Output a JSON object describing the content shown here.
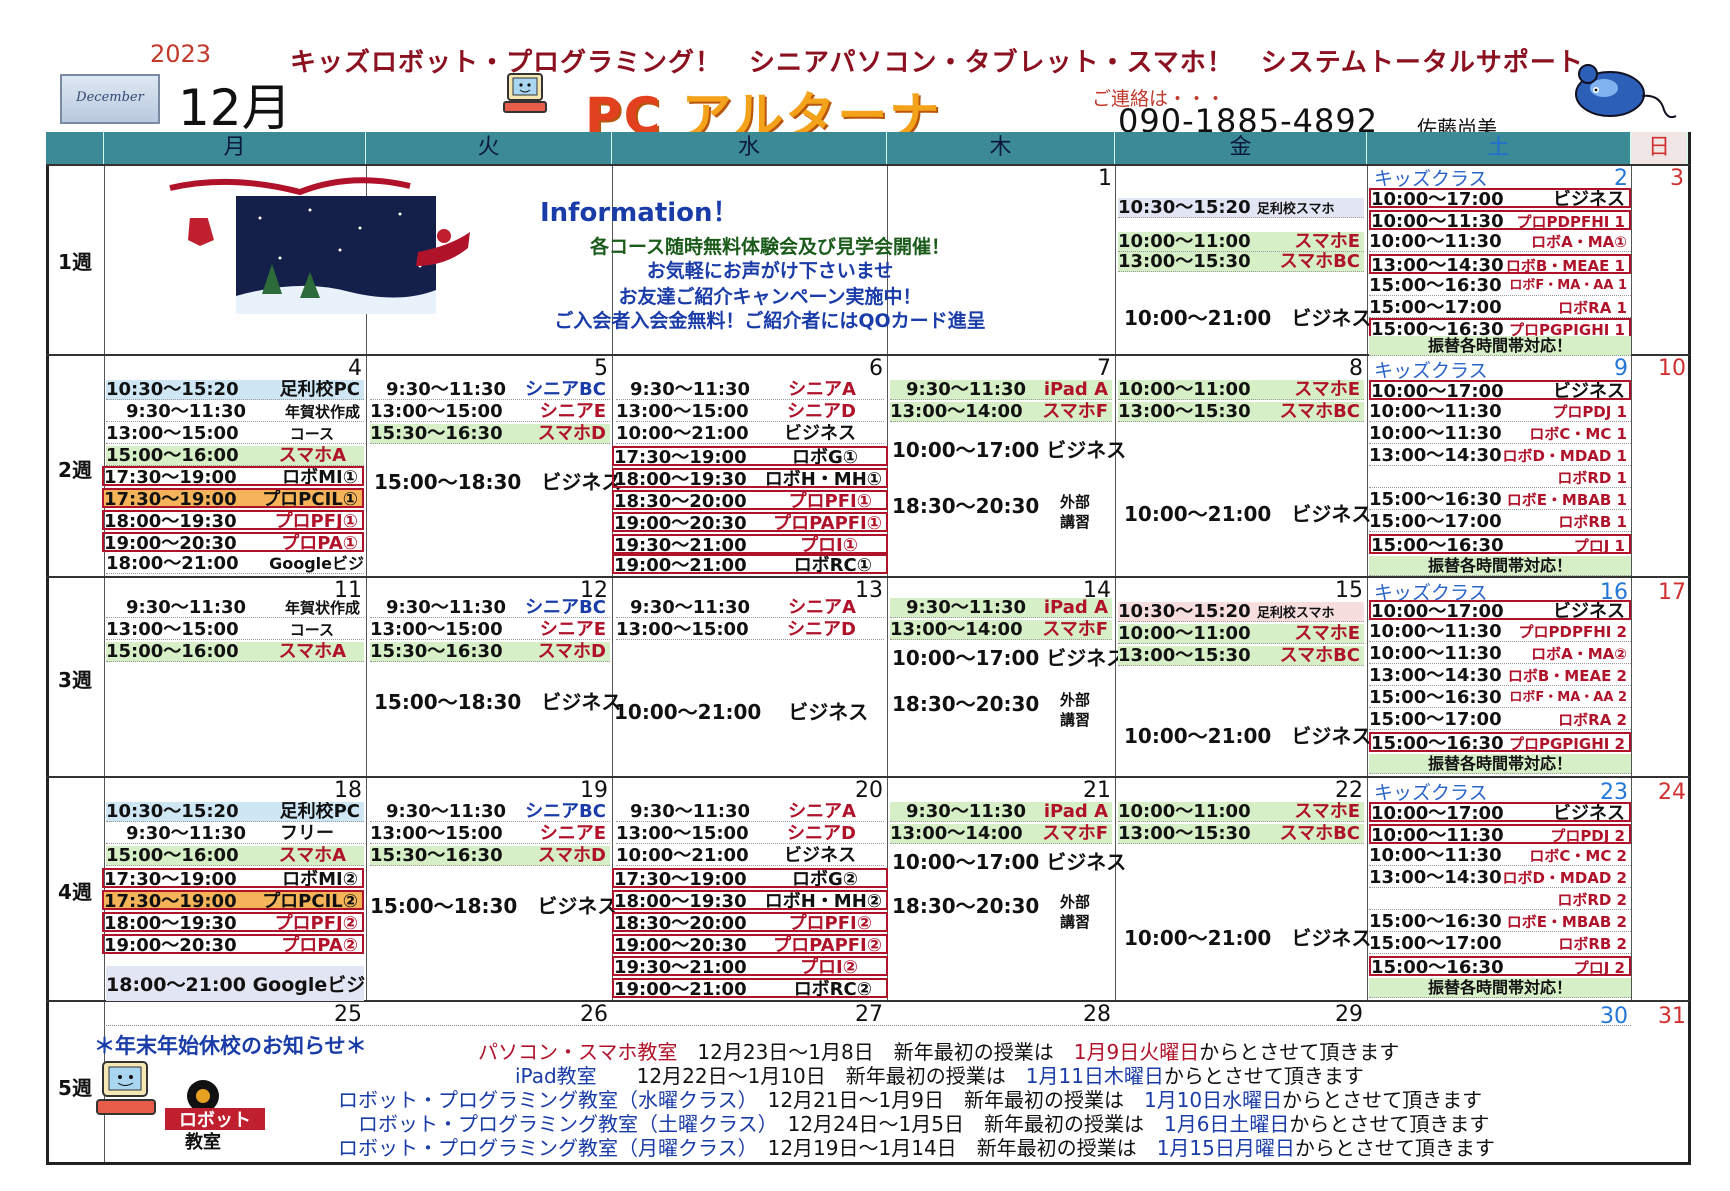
{
  "header": {
    "year": "2023",
    "tagline": "キッズロボット・プログラミング！　シニアパソコン・タブレット・スマホ！　システムトータルサポート",
    "month_label": "December",
    "month": "12月",
    "brand_pc": "PC",
    "brand_name": "アルターナ",
    "contact_label": "ご連絡は・・・",
    "phone": "090-1885-4892",
    "person": "佐藤尚美"
  },
  "weekdays": [
    "月",
    "火",
    "水",
    "木",
    "金",
    "土",
    "日"
  ],
  "weeks": [
    "1週",
    "2週",
    "3週",
    "4週",
    "5週"
  ],
  "days": {
    "w1": [
      "1",
      "2",
      "3"
    ],
    "w2": [
      "4",
      "5",
      "6",
      "7",
      "8",
      "9",
      "10"
    ],
    "w3": [
      "11",
      "12",
      "13",
      "14",
      "15",
      "16",
      "17"
    ],
    "w4": [
      "18",
      "19",
      "20",
      "21",
      "22",
      "23",
      "24"
    ],
    "w5": [
      "25",
      "26",
      "27",
      "28",
      "29",
      "30",
      "31"
    ]
  },
  "kids_label": "キッズクラス",
  "makeup_label": "振替各時間帯対応！",
  "info": {
    "title": "Information！",
    "lines": [
      "各コース随時無料体験会及び見学会開催！",
      "お気軽にお声がけ下さいませ",
      "お友達ご紹介キャンペーン実施中！",
      "ご入会者入会金無料！ご紹介者にはQOカード進呈"
    ]
  },
  "events": {
    "w1_fri": [
      {
        "t": "10:30～15:20",
        "n": "足利校スマホ"
      },
      {
        "t": "10:00～11:00",
        "n": "スマホE"
      },
      {
        "t": "13:00～15:30",
        "n": "スマホBC"
      }
    ],
    "w1_fri_biz": "10:00～21:00　ビジネス",
    "w1_sat": [
      {
        "t": "10:00～17:00",
        "n": "ビジネス"
      },
      {
        "t": "10:00～11:30",
        "n": "プロPDPFHI 1"
      },
      {
        "t": "10:00～11:30",
        "n": "ロボA・MA①"
      },
      {
        "t": "13:00～14:30",
        "n": "ロボB・MEAE 1"
      },
      {
        "t": "15:00～16:30",
        "n": "ロボF・MA・AA 1"
      },
      {
        "t": "15:00～17:00",
        "n": "ロボRA 1"
      },
      {
        "t": "15:00～16:30",
        "n": "プロPGPIGHI 1"
      }
    ],
    "w2_mon": [
      {
        "t": "10:30～15:20",
        "n": "足利校PC"
      },
      {
        "t": "9:30～11:30",
        "n": "年賀状作成"
      },
      {
        "t": "13:00～15:00",
        "n": "コース"
      },
      {
        "t": "15:00～16:00",
        "n": "スマホA"
      },
      {
        "t": "17:30～19:00",
        "n": "ロボMI①"
      },
      {
        "t": "17:30～19:00",
        "n": "プロPCIL①"
      },
      {
        "t": "18:00～19:30",
        "n": "プロPFJ①"
      },
      {
        "t": "19:00～20:30",
        "n": "プロPA①"
      },
      {
        "t": "18:00～21:00",
        "n": "Googleビジ"
      }
    ],
    "w2_tue": [
      {
        "t": "9:30～11:30",
        "n": "シニアBC"
      },
      {
        "t": "13:00～15:00",
        "n": "シニアE"
      },
      {
        "t": "15:30～16:30",
        "n": "スマホD"
      }
    ],
    "w2_tue_biz": "15:00～18:30　ビジネス",
    "w2_wed": [
      {
        "t": "9:30～11:30",
        "n": "シニアA"
      },
      {
        "t": "13:00～15:00",
        "n": "シニアD"
      },
      {
        "t": "10:00～21:00",
        "n": "ビジネス"
      },
      {
        "t": "17:30～19:00",
        "n": "ロボG①"
      },
      {
        "t": "18:00～19:30",
        "n": "ロボH・MH①"
      },
      {
        "t": "18:30～20:00",
        "n": "プロPFI①"
      },
      {
        "t": "19:00～20:30",
        "n": "プロPAPFI①"
      },
      {
        "t": "19:30～21:00",
        "n": "プロI①"
      },
      {
        "t": "19:00～21:00",
        "n": "ロボRC①"
      }
    ],
    "w2_thu": [
      {
        "t": "9:30～11:30",
        "n": "iPad A"
      },
      {
        "t": "13:00～14:00",
        "n": "スマホF"
      }
    ],
    "w2_thu_biz": "10:00～17:00 ビジネス",
    "ext_time": "18:30～20:30",
    "ext_label1": "外部",
    "ext_label2": "講習",
    "w2_fri": [
      {
        "t": "10:00～11:00",
        "n": "スマホE"
      },
      {
        "t": "13:00～15:30",
        "n": "スマホBC"
      }
    ],
    "fri_biz": "10:00～21:00　ビジネス",
    "w2_sat": [
      {
        "t": "10:00～17:00",
        "n": "ビジネス"
      },
      {
        "t": "10:00～11:30",
        "n": "プロPDJ 1"
      },
      {
        "t": "10:00～11:30",
        "n": "ロボC・MC 1"
      },
      {
        "t": "13:00～14:30",
        "n": "ロボD・MDAD 1"
      },
      {
        "t": "",
        "n": "ロボRD 1"
      },
      {
        "t": "15:00～16:30",
        "n": "ロボE・MBAB 1"
      },
      {
        "t": "15:00～17:00",
        "n": "ロボRB 1"
      },
      {
        "t": "15:00～16:30",
        "n": "プロJ 1"
      }
    ],
    "w3_mon": [
      {
        "t": "9:30～11:30",
        "n": "年賀状作成"
      },
      {
        "t": "13:00～15:00",
        "n": "コース"
      },
      {
        "t": "15:00～16:00",
        "n": "スマホA"
      }
    ],
    "w3_tue": [
      {
        "t": "9:30～11:30",
        "n": "シニアBC"
      },
      {
        "t": "13:00～15:00",
        "n": "シニアE"
      },
      {
        "t": "15:30～16:30",
        "n": "スマホD"
      }
    ],
    "w3_wed": [
      {
        "t": "9:30～11:30",
        "n": "シニアA"
      },
      {
        "t": "13:00～15:00",
        "n": "シニアD"
      }
    ],
    "w3_wed_biz": "10:00～21:00　 ビジネス",
    "w3_thu": [
      {
        "t": "9:30～11:30",
        "n": "iPad A"
      },
      {
        "t": "13:00～14:00",
        "n": "スマホF"
      }
    ],
    "w3_fri": [
      {
        "t": "10:30～15:20",
        "n": "足利校スマホ"
      },
      {
        "t": "10:00～11:00",
        "n": "スマホE"
      },
      {
        "t": "13:00～15:30",
        "n": "スマホBC"
      }
    ],
    "w3_sat": [
      {
        "t": "10:00～17:00",
        "n": "ビジネス"
      },
      {
        "t": "10:00～11:30",
        "n": "プロPDPFHI 2"
      },
      {
        "t": "10:00～11:30",
        "n": "ロボA・MA②"
      },
      {
        "t": "13:00～14:30",
        "n": "ロボB・MEAE 2"
      },
      {
        "t": "15:00～16:30",
        "n": "ロボF・MA・AA 2"
      },
      {
        "t": "15:00～17:00",
        "n": "ロボRA 2"
      },
      {
        "t": "15:00～16:30",
        "n": "プロPGPIGHI 2"
      }
    ],
    "w4_mon": [
      {
        "t": "10:30～15:20",
        "n": "足利校PC"
      },
      {
        "t": "9:30～11:30",
        "n": "フリー"
      },
      {
        "t": "15:00～16:00",
        "n": "スマホA"
      },
      {
        "t": "17:30～19:00",
        "n": "ロボMI②"
      },
      {
        "t": "17:30～19:00",
        "n": "プロPCIL②"
      },
      {
        "t": "18:00～19:30",
        "n": "プロPFJ②"
      },
      {
        "t": "19:00～20:30",
        "n": "プロPA②"
      }
    ],
    "w4_mon_google": "18:00～21:00 Googleビジ",
    "w4_tue": [
      {
        "t": "9:30～11:30",
        "n": "シニアBC"
      },
      {
        "t": "13:00～15:00",
        "n": "シニアE"
      },
      {
        "t": "15:30～16:30",
        "n": "スマホD"
      }
    ],
    "w4_wed": [
      {
        "t": "9:30～11:30",
        "n": "シニアA"
      },
      {
        "t": "13:00～15:00",
        "n": "シニアD"
      },
      {
        "t": "10:00～21:00",
        "n": "ビジネス"
      },
      {
        "t": "17:30～19:00",
        "n": "ロボG②"
      },
      {
        "t": "18:00～19:30",
        "n": "ロボH・MH②"
      },
      {
        "t": "18:30～20:00",
        "n": "プロPFI②"
      },
      {
        "t": "19:00～20:30",
        "n": "プロPAPFI②"
      },
      {
        "t": "19:30～21:00",
        "n": "プロI②"
      },
      {
        "t": "19:00～21:00",
        "n": "ロボRC②"
      }
    ],
    "w4_thu": [
      {
        "t": "9:30～11:30",
        "n": "iPad A"
      },
      {
        "t": "13:00～14:00",
        "n": "スマホF"
      }
    ],
    "w4_fri": [
      {
        "t": "10:00～11:00",
        "n": "スマホE"
      },
      {
        "t": "13:00～15:30",
        "n": "スマホBC"
      }
    ],
    "w4_sat": [
      {
        "t": "10:00～17:00",
        "n": "ビジネス"
      },
      {
        "t": "10:00～11:30",
        "n": "プロPDJ 2"
      },
      {
        "t": "10:00～11:30",
        "n": "ロボC・MC 2"
      },
      {
        "t": "13:00～14:30",
        "n": "ロボD・MDAD 2"
      },
      {
        "t": "",
        "n": "ロボRD 2"
      },
      {
        "t": "15:00～16:30",
        "n": "ロボE・MBAB 2"
      },
      {
        "t": "15:00～17:00",
        "n": "ロボRB 2"
      },
      {
        "t": "15:00～16:30",
        "n": "プロJ 2"
      }
    ]
  },
  "notice": {
    "title": "＊年末年始休校のお知らせ＊",
    "rows": [
      {
        "cls": "パソコン・スマホ教室",
        "period": "12月23日～1月8日",
        "mid": "新年最初の授業は",
        "date": "1月9日火曜日",
        "tail": "からとさせて頂きます"
      },
      {
        "cls": "iPad教室",
        "period": "12月22日～1月10日",
        "mid": "新年最初の授業は",
        "date": "1月11日木曜日",
        "tail": "からとさせて頂きます"
      },
      {
        "cls": "ロボット・プログラミング教室（水曜クラス）",
        "period": "12月21日～1月9日",
        "mid": "新年最初の授業は",
        "date": "1月10日水曜日",
        "tail": "からとさせて頂きます"
      },
      {
        "cls": "ロボット・プログラミング教室（土曜クラス）",
        "period": "12月24日～1月5日",
        "mid": "新年最初の授業は",
        "date": "1月6日土曜日",
        "tail": "からとさせて頂きます"
      },
      {
        "cls": "ロボット・プログラミング教室（月曜クラス）",
        "period": "12月19日～1月14日",
        "mid": "新年最初の授業は",
        "date": "1月15日月曜日",
        "tail": "からとさせて頂きます"
      }
    ]
  },
  "logo": {
    "line1": "ロボット",
    "line2": "教室"
  },
  "colors": {
    "header_teal": "#3b8a96",
    "accent_red": "#b0122a",
    "accent_blue": "#1a3ca8",
    "brand_orange": "#f4a21a"
  },
  "icons": [
    "pc-mascot-icon",
    "mouse-mascot-icon",
    "christmas-sleigh-illustration",
    "robot-gear-logo"
  ]
}
